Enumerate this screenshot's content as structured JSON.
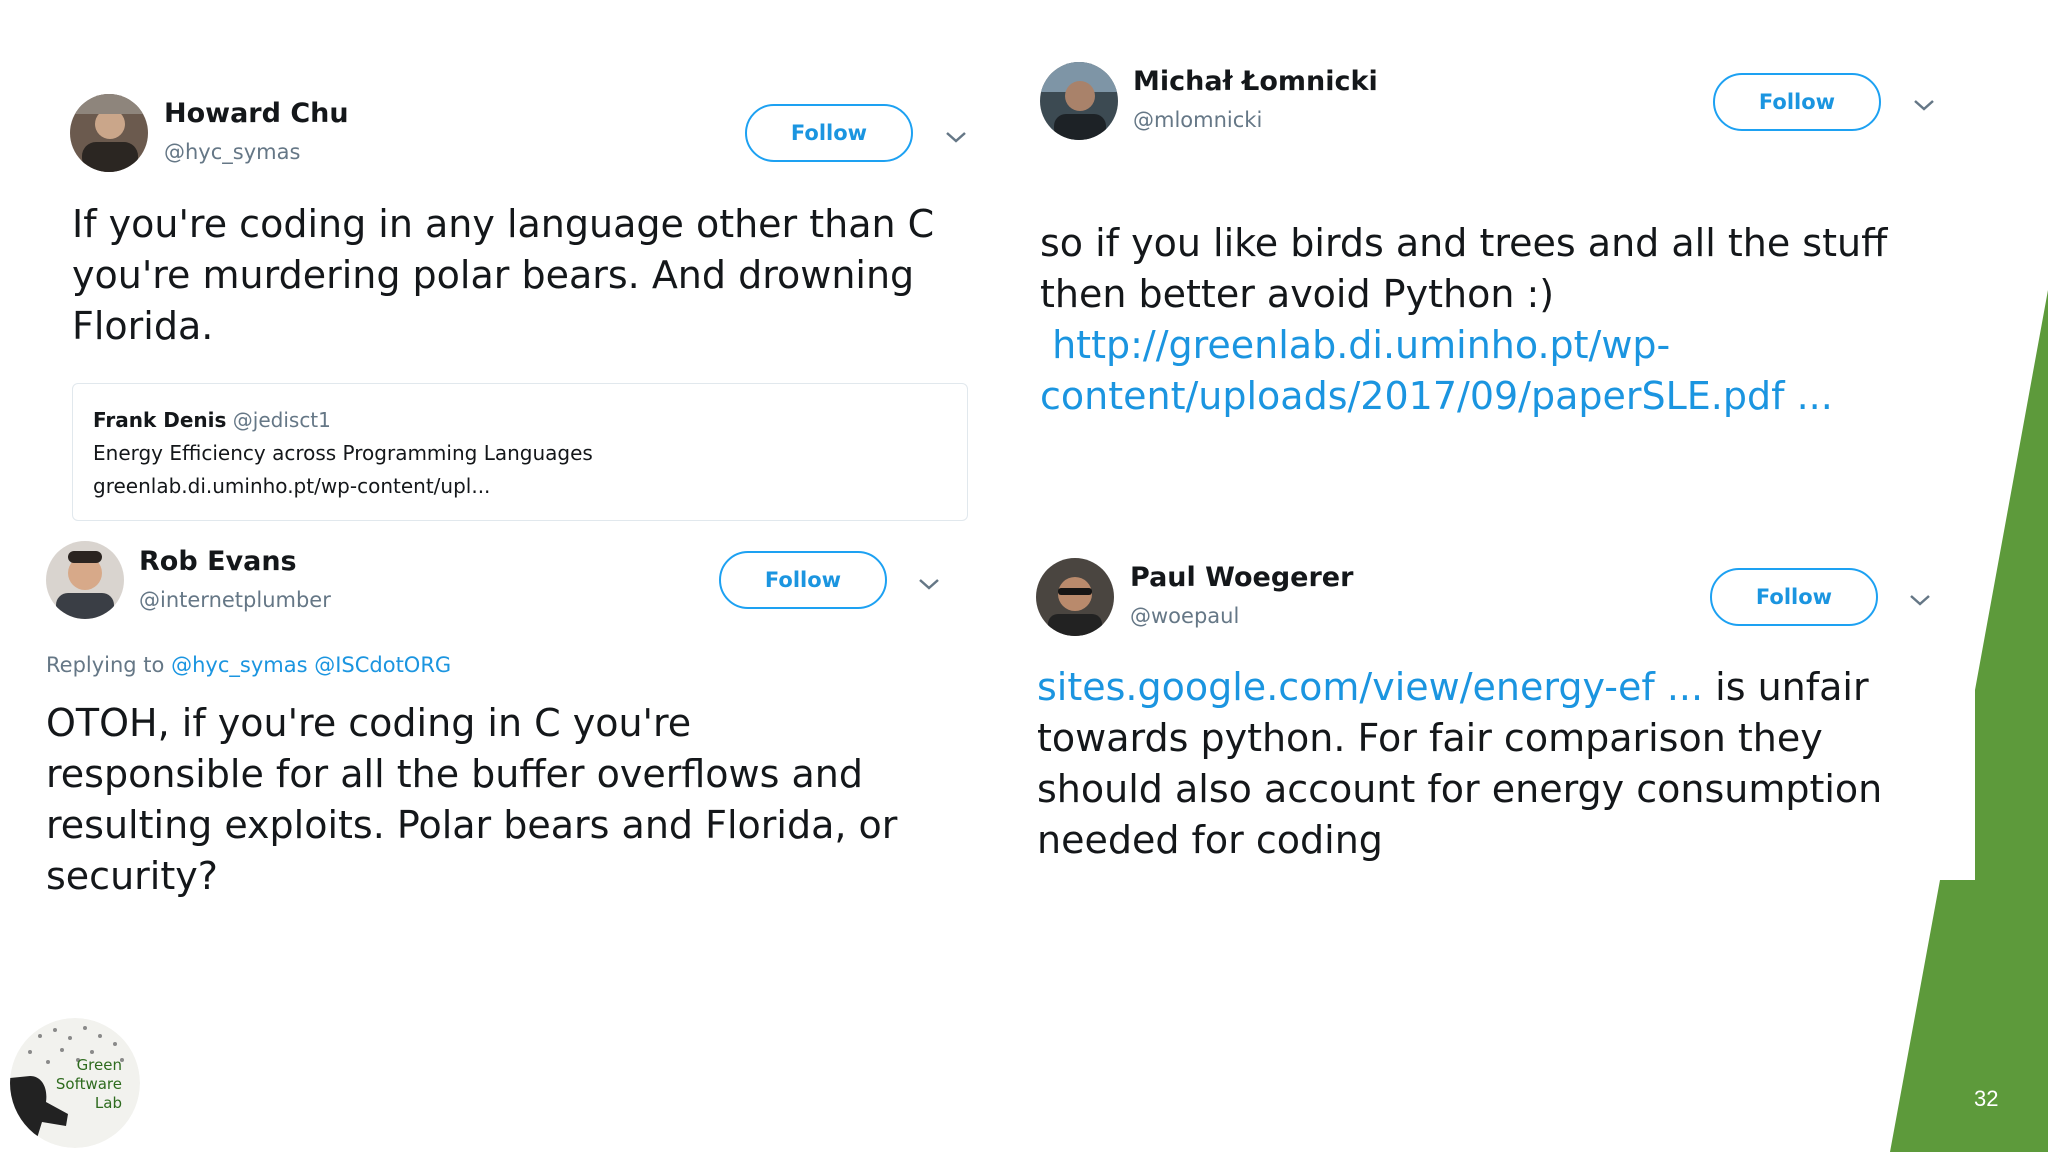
{
  "page_number": "32",
  "colors": {
    "accent_green": "#5d9a3b",
    "link_blue": "#1b95e0",
    "follow_border": "#1da1f2"
  },
  "tweets": [
    {
      "name": "Howard Chu",
      "handle": "@hyc_symas",
      "follow_label": "Follow",
      "body_lines": [
        "If you're coding in any language other than C",
        "you're murdering polar bears. And drowning",
        "Florida."
      ],
      "quote": {
        "name": "Frank Denis",
        "handle": "@jedisct1",
        "title": "Energy Efficiency across Programming Languages",
        "url": "greenlab.di.uminho.pt/wp-content/upl..."
      }
    },
    {
      "name": "Rob Evans",
      "handle": "@internetplumber",
      "follow_label": "Follow",
      "replying_prefix": "Replying to",
      "replying_to": [
        "@hyc_symas",
        "@ISCdotORG"
      ],
      "body_lines": [
        "OTOH, if you're coding in C you're",
        "responsible for all the buffer overflows and",
        "resulting exploits. Polar bears and Florida, or",
        "security?"
      ]
    },
    {
      "name": "Michał Łomnicki",
      "handle": "@mlomnicki",
      "follow_label": "Follow",
      "body_lines": [
        "so if you like birds and trees and all the stuff",
        "then better avoid Python :)"
      ],
      "link_lines": [
        " http://greenlab.di.uminho.pt/wp-",
        "content/uploads/2017/09/paperSLE.pdf ..."
      ]
    },
    {
      "name": "Paul Woegerer",
      "handle": "@woepaul",
      "follow_label": "Follow",
      "link": "sites.google.com/view/energy-ef ...",
      "link_suffix": " is unfair",
      "body_lines": [
        "towards python. For fair comparison they",
        "should also account for energy consumption",
        "needed for coding"
      ]
    }
  ],
  "logo": {
    "lines": [
      "Green",
      "Software",
      "Lab"
    ]
  }
}
